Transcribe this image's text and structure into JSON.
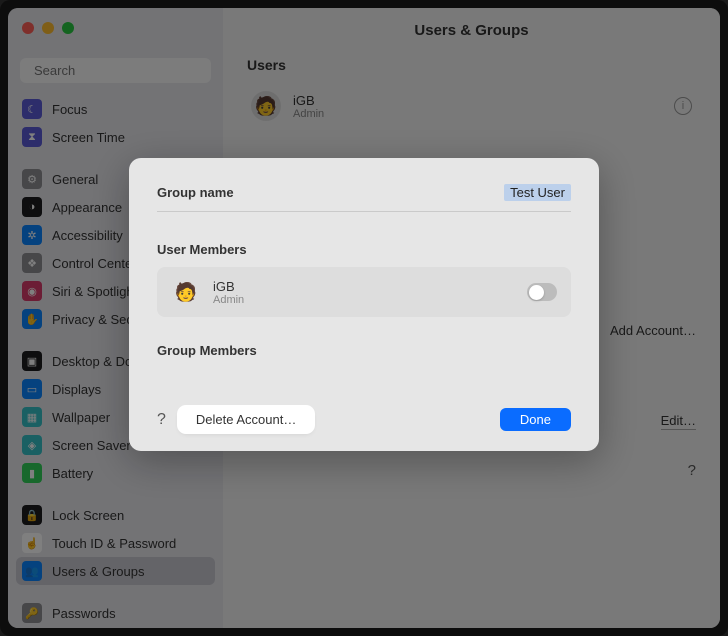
{
  "window": {
    "title": "Users & Groups"
  },
  "search": {
    "placeholder": "Search"
  },
  "sidebar": {
    "groups": [
      [
        {
          "label": "Focus",
          "color": "#5b5bd6",
          "glyph": "☾"
        },
        {
          "label": "Screen Time",
          "color": "#5b5bd6",
          "glyph": "⧗"
        }
      ],
      [
        {
          "label": "General",
          "color": "#8e8e93",
          "glyph": "⚙"
        },
        {
          "label": "Appearance",
          "color": "#1c1c1e",
          "glyph": "◑"
        },
        {
          "label": "Accessibility",
          "color": "#0a84ff",
          "glyph": "✲"
        },
        {
          "label": "Control Center",
          "color": "#8e8e93",
          "glyph": "❖"
        },
        {
          "label": "Siri & Spotlight",
          "color": "#d83a6a",
          "glyph": "◉"
        },
        {
          "label": "Privacy & Security",
          "color": "#0a84ff",
          "glyph": "✋"
        }
      ],
      [
        {
          "label": "Desktop & Dock",
          "color": "#1c1c1e",
          "glyph": "▣"
        },
        {
          "label": "Displays",
          "color": "#0a84ff",
          "glyph": "▭"
        },
        {
          "label": "Wallpaper",
          "color": "#34c1c7",
          "glyph": "▦"
        },
        {
          "label": "Screen Saver",
          "color": "#34c1c7",
          "glyph": "◈"
        },
        {
          "label": "Battery",
          "color": "#30d158",
          "glyph": "▮"
        }
      ],
      [
        {
          "label": "Lock Screen",
          "color": "#1c1c1e",
          "glyph": "🔒"
        },
        {
          "label": "Touch ID & Password",
          "color": "#ffffff",
          "glyph": "☝"
        },
        {
          "label": "Users & Groups",
          "color": "#0a84ff",
          "glyph": "👥",
          "selected": true
        }
      ],
      [
        {
          "label": "Passwords",
          "color": "#8e8e93",
          "glyph": "🔑"
        }
      ]
    ]
  },
  "main": {
    "users_heading": "Users",
    "users": [
      {
        "name": "iGB",
        "role": "Admin"
      }
    ],
    "add_account": "Add Account…",
    "edit": "Edit…",
    "help": "?"
  },
  "modal": {
    "group_name_label": "Group name",
    "group_name_value": "Test User",
    "user_members_label": "User Members",
    "members": [
      {
        "name": "iGB",
        "role": "Admin",
        "enabled": false
      }
    ],
    "group_members_label": "Group Members",
    "help": "?",
    "delete": "Delete Account…",
    "done": "Done"
  }
}
